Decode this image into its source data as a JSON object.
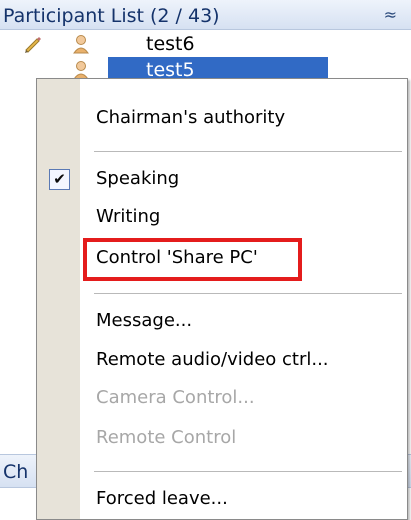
{
  "panel": {
    "title": "Participant List (2 / 43)",
    "collapse_glyph": "≈"
  },
  "participants": [
    {
      "name": "test6",
      "selected": false,
      "icons": [
        "pencil-icon",
        "user-icon"
      ]
    },
    {
      "name": "test5",
      "selected": true,
      "icons": [
        "user-icon"
      ]
    }
  ],
  "chat_panel": {
    "title_fragment": "Ch",
    "collapse_glyph": "≈"
  },
  "context_menu": {
    "items": [
      {
        "label": "Chairman's authority",
        "enabled": true
      },
      {
        "label": "Speaking",
        "enabled": true,
        "checked": true,
        "check_glyph": "✔"
      },
      {
        "label": "Writing",
        "enabled": true
      },
      {
        "label": "Control 'Share PC'",
        "enabled": true,
        "highlighted": true
      },
      {
        "label": "Message...",
        "enabled": true
      },
      {
        "label": "Remote audio/video ctrl...",
        "enabled": true
      },
      {
        "label": "Camera Control...",
        "enabled": false
      },
      {
        "label": "Remote Control",
        "enabled": false
      },
      {
        "label": "Forced leave...",
        "enabled": true
      }
    ]
  },
  "colors": {
    "selection": "#316ac5",
    "highlight_border": "#e41c1c",
    "header_text": "#15336b",
    "disabled_text": "#a7a7a7"
  }
}
